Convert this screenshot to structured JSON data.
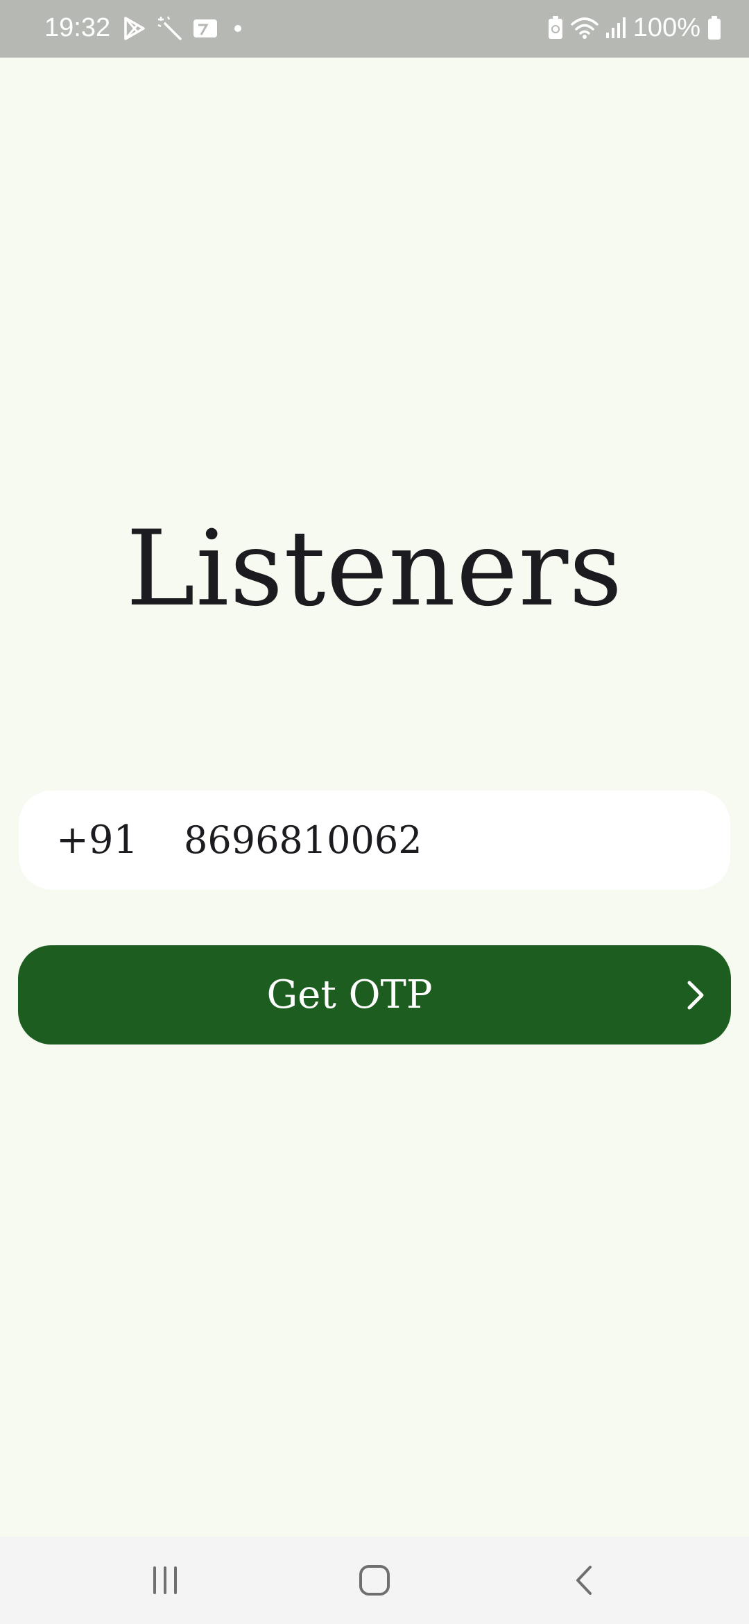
{
  "status_bar": {
    "time": "19:32",
    "battery_percent": "100%",
    "icons_left": [
      "play-store-icon",
      "magic-wand-icon",
      "cast-card-icon",
      "notification-dot-icon"
    ],
    "icons_right": [
      "battery-saver-icon",
      "wifi-icon",
      "signal-icon",
      "battery-icon"
    ]
  },
  "app": {
    "title": "Listeners"
  },
  "login": {
    "country_code": "+91",
    "phone_number": "8696810062",
    "submit_label": "Get OTP"
  },
  "nav_bar": {
    "buttons": [
      "recent-apps",
      "home",
      "back"
    ]
  },
  "colors": {
    "background": "#f7faf0",
    "status_bar": "#b6b9b3",
    "button_primary": "#1d5e20",
    "field_bg": "#ffffff",
    "text_primary": "#1c1b1f"
  }
}
